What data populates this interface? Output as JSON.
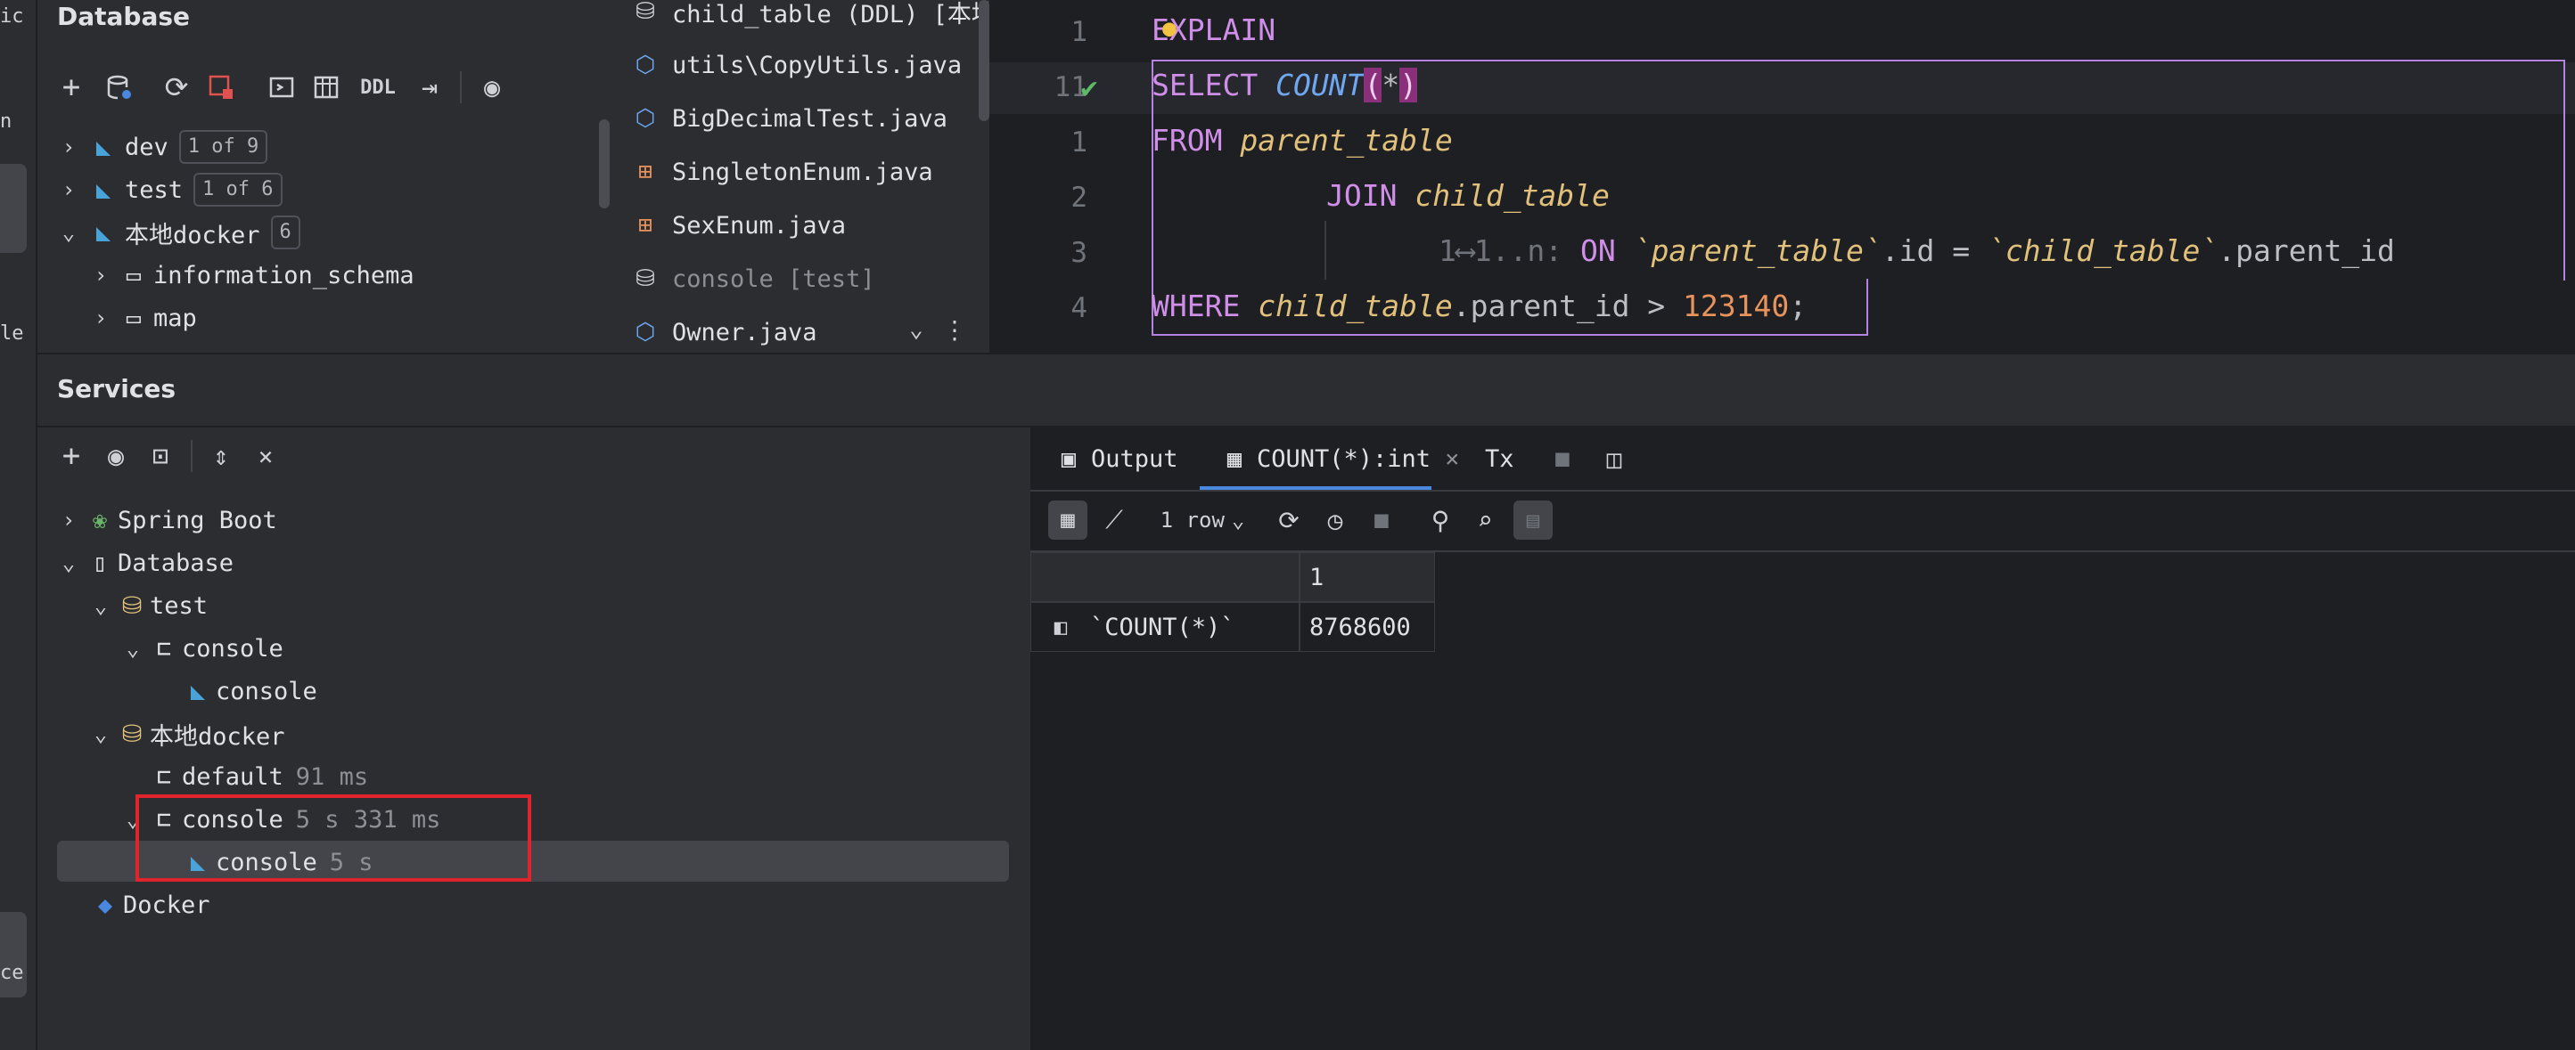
{
  "strip": {
    "labels": [
      "ic",
      "n",
      "le",
      "ce"
    ]
  },
  "database_panel": {
    "title": "Database",
    "toolbar_ddl": "DDL",
    "tree": [
      {
        "name": "dev",
        "badge": "1 of 9"
      },
      {
        "name": "test",
        "badge": "1 of 6"
      },
      {
        "name": "本地docker",
        "badge": "6"
      },
      {
        "name": "information_schema"
      },
      {
        "name": "map"
      }
    ]
  },
  "files": [
    {
      "name": "child_table (DDL) [本地",
      "icon": "database-icon"
    },
    {
      "name": "utils\\CopyUtils.java",
      "icon": "class-icon"
    },
    {
      "name": "BigDecimalTest.java",
      "icon": "class-icon"
    },
    {
      "name": "SingletonEnum.java",
      "icon": "enum-icon"
    },
    {
      "name": "SexEnum.java",
      "icon": "enum-icon"
    },
    {
      "name": "console [test]",
      "icon": "database-icon"
    },
    {
      "name": "Owner.java",
      "icon": "class-icon"
    }
  ],
  "editor": {
    "line_numbers": [
      "1",
      "11",
      "1",
      "2",
      "3",
      "4"
    ],
    "lines": {
      "l1_kw": "EXPLAIN",
      "l2_kw": "SELECT",
      "l2_fn": "COUNT",
      "l2_paren_open": "(",
      "l2_star": "*",
      "l2_paren_close": ")",
      "l3_kw": "FROM",
      "l3_tb": "parent_table",
      "l4_kw": "JOIN",
      "l4_tb": "child_table",
      "l5_hint": "1⟷1..n:",
      "l5_kw": "ON",
      "l5_tb1": "`parent_table`",
      "l5_mid": ".id = ",
      "l5_tb2": "`child_table`",
      "l5_end": ".parent_id",
      "l6_kw": "WHERE",
      "l6_tb": "child_table",
      "l6_mid": ".parent_id > ",
      "l6_num": "123140",
      "l6_end": ";"
    }
  },
  "services": {
    "title": "Services",
    "tree": [
      {
        "label": "Spring Boot"
      },
      {
        "label": "Database"
      },
      {
        "label": "test"
      },
      {
        "label": "console"
      },
      {
        "label": "console"
      },
      {
        "label": "本地docker"
      },
      {
        "label": "default",
        "time": "91 ms"
      },
      {
        "label": "console",
        "time": "5 s 331 ms"
      },
      {
        "label": "console",
        "time": "5 s"
      },
      {
        "label": "Docker"
      }
    ],
    "tabs": {
      "output": "Output",
      "result": "COUNT(*):int",
      "tx": "Tx"
    },
    "result_toolbar": {
      "rows": "1 row"
    },
    "grid": {
      "column_header": "1",
      "row_label": "`COUNT(*)`",
      "value": "8768600"
    }
  },
  "colors": {
    "highlight_box": "#e0242b",
    "selection_outline": "#b482e0",
    "check": "#5fb865"
  }
}
